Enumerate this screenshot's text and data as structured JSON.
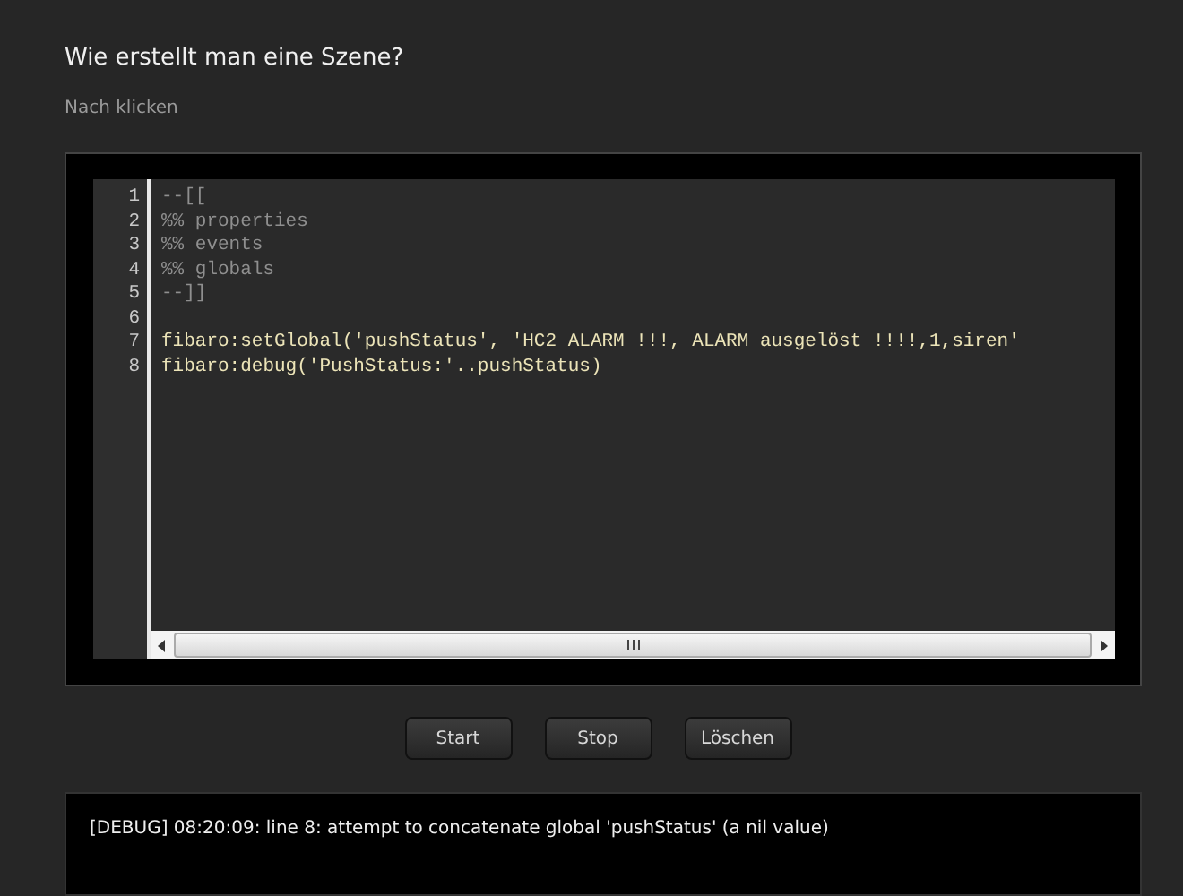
{
  "heading": "Wie erstellt man eine Szene?",
  "subheading": "Nach klicken",
  "editor": {
    "lines": [
      {
        "number": "1",
        "kind": "comment",
        "code": "--[["
      },
      {
        "number": "2",
        "kind": "comment",
        "code": "%% properties"
      },
      {
        "number": "3",
        "kind": "comment",
        "code": "%% events"
      },
      {
        "number": "4",
        "kind": "comment",
        "code": "%% globals"
      },
      {
        "number": "5",
        "kind": "comment",
        "code": "--]]"
      },
      {
        "number": "6",
        "kind": "blank"
      },
      {
        "number": "7",
        "kind": "code",
        "code": "fibaro:setGlobal('pushStatus', 'HC2 ALARM !!!, ALARM ausgelöst !!!!,1,siren'"
      },
      {
        "number": "8",
        "kind": "code",
        "code": "fibaro:debug('PushStatus:'..pushStatus)"
      }
    ]
  },
  "buttons": [
    "Start",
    "Stop",
    "Löschen"
  ],
  "debug_output": "[DEBUG] 08:20:09: line 8: attempt to concatenate global 'pushStatus' (a nil value)"
}
